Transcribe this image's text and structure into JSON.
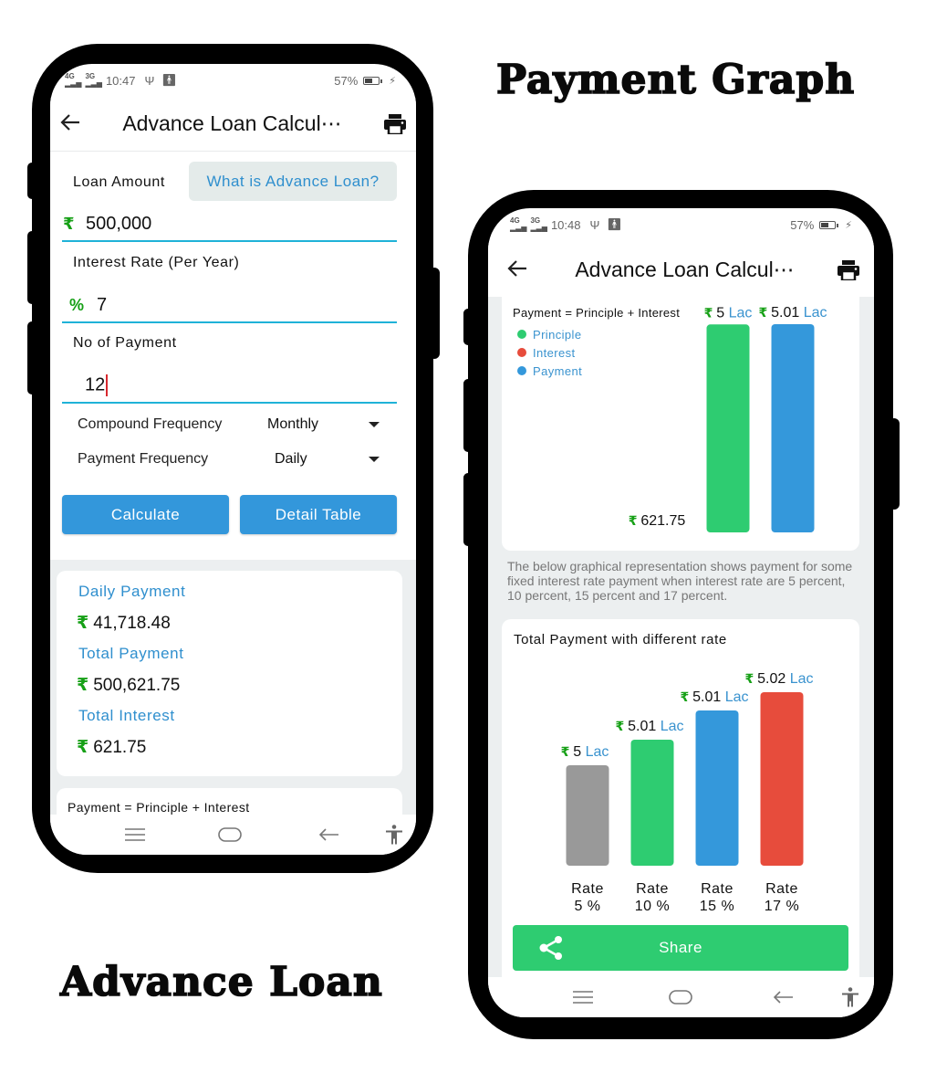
{
  "promo": {
    "title_graph": "Payment Graph",
    "title_loan": "Advance Loan"
  },
  "left_screen": {
    "status": {
      "network1": "4G",
      "network2": "3G",
      "time": "10:47",
      "battery_pct": "57%",
      "battery_level": 0.57
    },
    "appbar": {
      "title": "Advance Loan Calcul⋯",
      "back_icon": "arrow-left-icon",
      "print_icon": "printer-icon"
    },
    "form": {
      "loan_amount_label": "Loan Amount",
      "what_is_button": "What is Advance Loan?",
      "loan_amount_prefix": "₹",
      "loan_amount_value": "500,000",
      "interest_rate_label": "Interest Rate (Per Year)",
      "interest_rate_prefix": "%",
      "interest_rate_value": "7",
      "no_of_payment_label": "No of Payment",
      "no_of_payment_value": "12",
      "compound_frequency_label": "Compound Frequency",
      "compound_frequency_value": "Monthly",
      "payment_frequency_label": "Payment Frequency",
      "payment_frequency_value": "Daily",
      "calculate_button": "Calculate",
      "detail_table_button": "Detail Table"
    },
    "results": {
      "currency": "₹",
      "daily_payment_label": "Daily Payment",
      "daily_payment_value": "41,718.48",
      "total_payment_label": "Total Payment",
      "total_payment_value": "500,621.75",
      "total_interest_label": "Total Interest",
      "total_interest_value": "621.75"
    },
    "formula_text": "Payment = Principle + Interest"
  },
  "right_screen": {
    "status": {
      "network1": "4G",
      "network2": "3G",
      "time": "10:48",
      "battery_pct": "57%",
      "battery_level": 0.57
    },
    "appbar": {
      "title": "Advance Loan Calcul⋯",
      "back_icon": "arrow-left-icon",
      "print_icon": "printer-icon"
    },
    "description": "The below graphical representation shows payment for some fixed interest rate payment when interest rate are 5 percent, 10 percent, 15 percent and 17 percent.",
    "share_button": "Share"
  },
  "navbar": {
    "recents_icon": "menu-lines-icon",
    "home_icon": "home-pill-icon",
    "back_icon": "back-arrow-icon",
    "accessibility_icon": "accessibility-icon"
  },
  "colors": {
    "accent_blue": "#3397db",
    "label_blue": "#2f8fce",
    "field_underline": "#1fb2d8",
    "currency_green": "#16a016",
    "principle_green": "#2ecc71",
    "interest_red": "#e74c3c",
    "payment_blue": "#3498db",
    "rate5_grey": "#999999"
  },
  "chart_data": [
    {
      "type": "bar",
      "title": "Payment = Principle + Interest",
      "legend": [
        "Principle",
        "Interest",
        "Payment"
      ],
      "legend_position": "top-left",
      "categories": [
        "Interest",
        "Principle",
        "Payment"
      ],
      "values": [
        621.75,
        500000,
        500621.75
      ],
      "labels": [
        {
          "currency": "₹",
          "number": "621.75",
          "unit": ""
        },
        {
          "currency": "₹",
          "number": "5",
          "unit": "Lac"
        },
        {
          "currency": "₹",
          "number": "5.01",
          "unit": "Lac"
        }
      ],
      "colors": [
        "#e74c3c",
        "#2ecc71",
        "#3498db"
      ],
      "xlabel": "",
      "ylabel": "",
      "grid": false
    },
    {
      "type": "bar",
      "title": "Total Payment with different rate",
      "categories": [
        "Rate 5 %",
        "Rate 10 %",
        "Rate 15 %",
        "Rate 17 %"
      ],
      "category_lines": [
        [
          "Rate",
          "5 %"
        ],
        [
          "Rate",
          "10 %"
        ],
        [
          "Rate",
          "15 %"
        ],
        [
          "Rate",
          "17 %"
        ]
      ],
      "values_lac": [
        5.0,
        5.01,
        5.01,
        5.02
      ],
      "labels": [
        {
          "currency": "₹",
          "number": "5",
          "unit": "Lac"
        },
        {
          "currency": "₹",
          "number": "5.01",
          "unit": "Lac"
        },
        {
          "currency": "₹",
          "number": "5.01",
          "unit": "Lac"
        },
        {
          "currency": "₹",
          "number": "5.02",
          "unit": "Lac"
        }
      ],
      "colors": [
        "#999999",
        "#2ecc71",
        "#3498db",
        "#e74c3c"
      ],
      "xlabel": "",
      "ylabel": "",
      "grid": false
    }
  ]
}
